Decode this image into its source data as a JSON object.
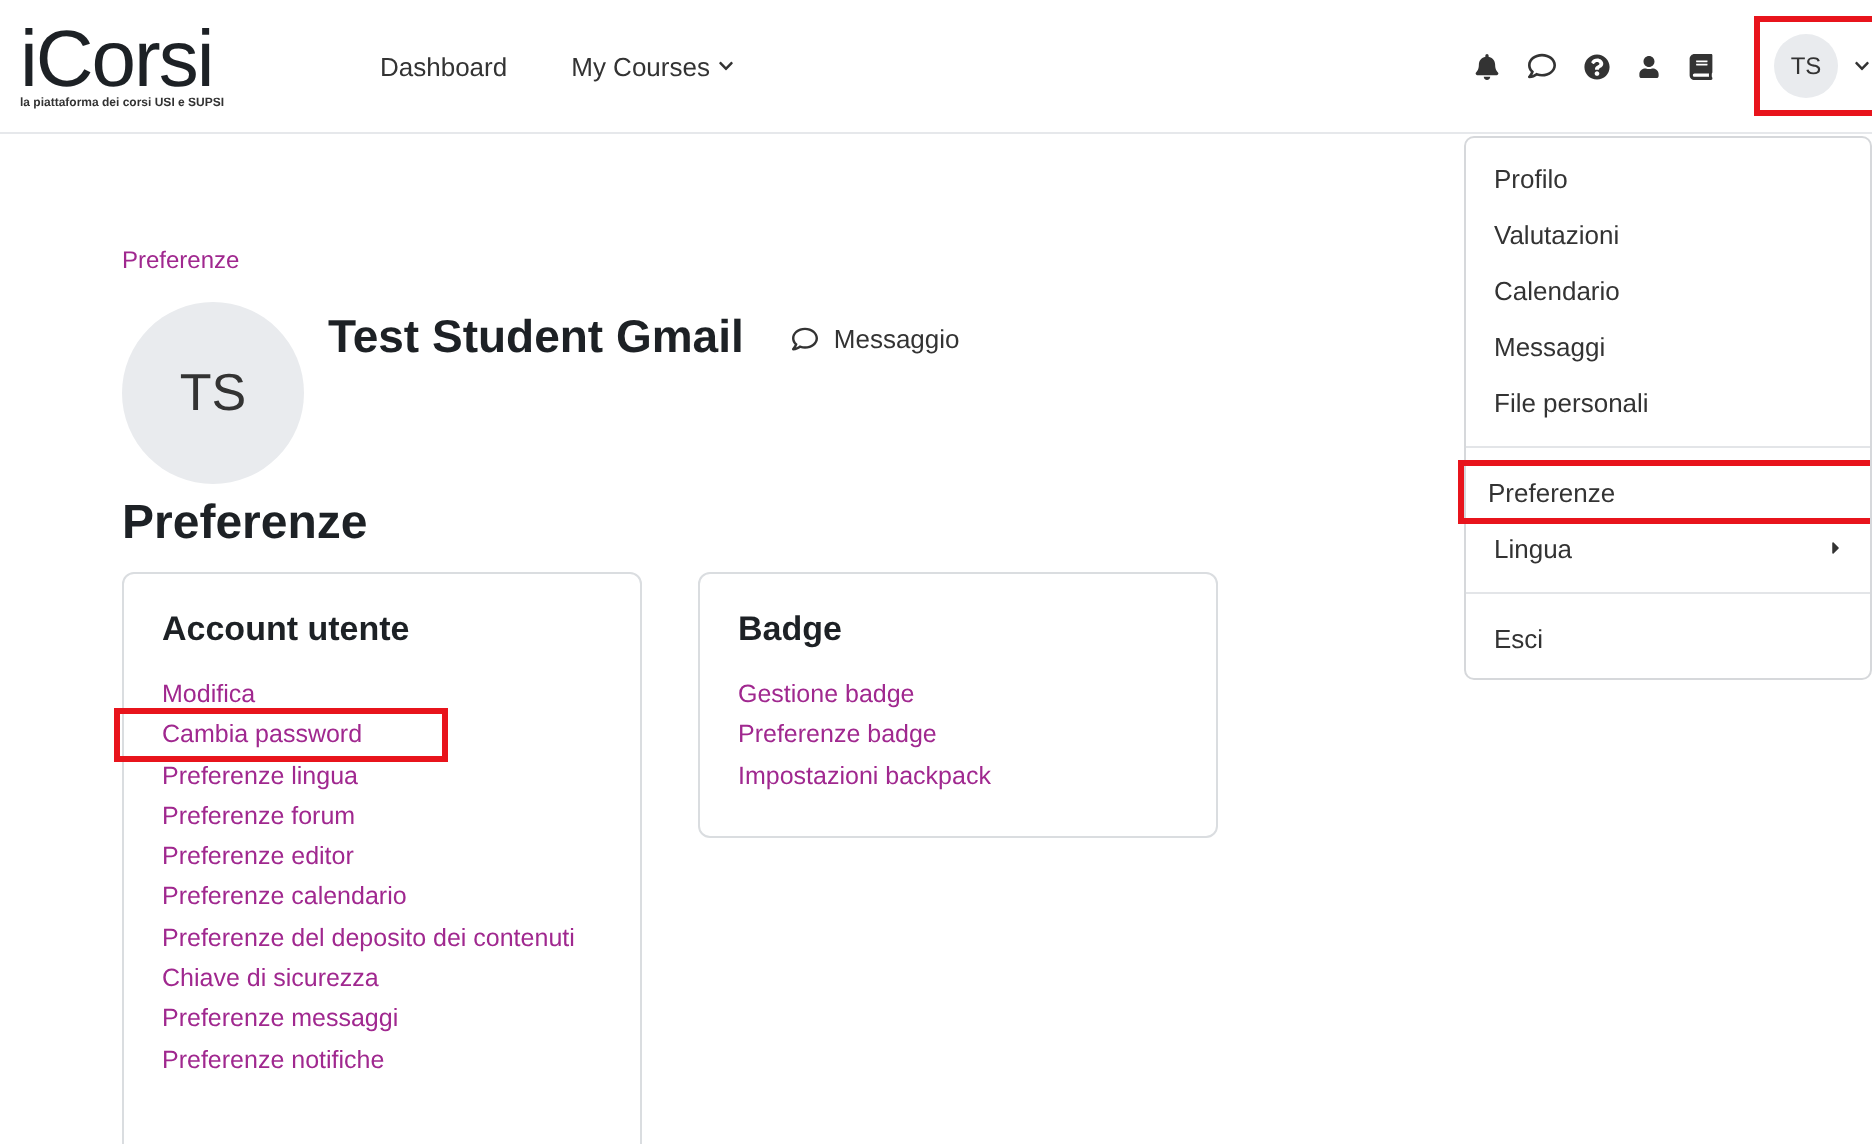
{
  "header": {
    "logo": {
      "title": "iCorsi",
      "tagline": "la piattaforma dei corsi USI e SUPSI"
    },
    "nav": [
      {
        "label": "Dashboard",
        "has_menu": false
      },
      {
        "label": "My Courses",
        "has_menu": true
      }
    ],
    "user_menu": {
      "initials": "TS",
      "highlighted": true
    }
  },
  "user_dropdown": {
    "groups": [
      [
        {
          "label": "Profilo",
          "highlighted": false,
          "has_submenu": false
        },
        {
          "label": "Valutazioni",
          "highlighted": false,
          "has_submenu": false
        },
        {
          "label": "Calendario",
          "highlighted": false,
          "has_submenu": false
        },
        {
          "label": "Messaggi",
          "highlighted": false,
          "has_submenu": false
        },
        {
          "label": "File personali",
          "highlighted": false,
          "has_submenu": false
        }
      ],
      [
        {
          "label": "Preferenze",
          "highlighted": true,
          "has_submenu": false
        },
        {
          "label": "Lingua",
          "highlighted": false,
          "has_submenu": true
        }
      ],
      [
        {
          "label": "Esci",
          "highlighted": false,
          "has_submenu": false
        }
      ]
    ]
  },
  "breadcrumb": "Preferenze",
  "profile": {
    "initials": "TS",
    "name": "Test Student Gmail",
    "message_link": "Messaggio"
  },
  "page_title": "Preferenze",
  "cards": [
    {
      "title": "Account utente",
      "links": [
        {
          "label": "Modifica",
          "highlighted": false
        },
        {
          "label": "Cambia password",
          "highlighted": true
        },
        {
          "label": "Preferenze lingua",
          "highlighted": false
        },
        {
          "label": "Preferenze forum",
          "highlighted": false
        },
        {
          "label": "Preferenze editor",
          "highlighted": false
        },
        {
          "label": "Preferenze calendario",
          "highlighted": false
        },
        {
          "label": "Preferenze del deposito dei contenuti",
          "highlighted": false
        },
        {
          "label": "Chiave di sicurezza",
          "highlighted": false
        },
        {
          "label": "Preferenze messaggi",
          "highlighted": false
        },
        {
          "label": "Preferenze notifiche",
          "highlighted": false
        }
      ]
    },
    {
      "title": "Badge",
      "links": [
        {
          "label": "Gestione badge",
          "highlighted": false
        },
        {
          "label": "Preferenze badge",
          "highlighted": false
        },
        {
          "label": "Impostazioni backpack",
          "highlighted": false
        }
      ]
    }
  ]
}
